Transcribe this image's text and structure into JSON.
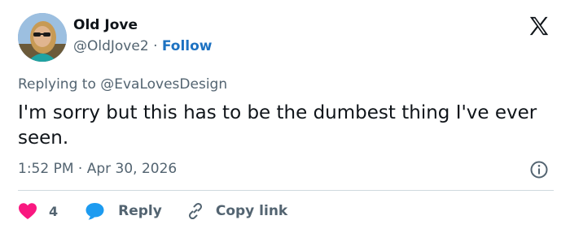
{
  "tweet": {
    "author": {
      "display_name": "Old Jove",
      "handle": "@OldJove2",
      "separator": "·",
      "follow_label": "Follow"
    },
    "replying_to_prefix": "Replying to",
    "replying_to_handle": "@EvaLovesDesign",
    "text": "I'm sorry but this has to be the dumbest thing I've ever seen.",
    "time": "1:52 PM",
    "date_separator": "·",
    "date": "Apr 30, 2026"
  },
  "actions": {
    "like_count": "4",
    "reply_label": "Reply",
    "copy_link_label": "Copy link"
  },
  "icons": {
    "logo": "x-logo-icon",
    "info": "info-icon",
    "like": "heart-icon",
    "reply": "speech-bubble-icon",
    "copy_link": "link-icon"
  },
  "colors": {
    "text_primary": "#0f1419",
    "text_secondary": "#536471",
    "follow": "#1d72c2",
    "like": "#f91880",
    "reply": "#1d9bf0",
    "divider": "#cfd9de"
  }
}
